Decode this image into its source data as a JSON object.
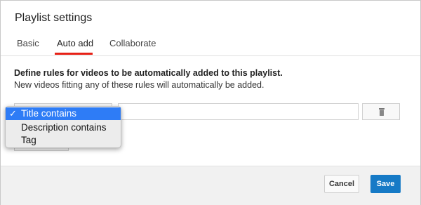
{
  "dialog": {
    "title": "Playlist settings"
  },
  "tabs": [
    {
      "label": "Basic",
      "active": false
    },
    {
      "label": "Auto add",
      "active": true
    },
    {
      "label": "Collaborate",
      "active": false
    }
  ],
  "rules": {
    "heading": "Define rules for videos to be automatically added to this playlist.",
    "subtext": "New videos fitting any of these rules will automatically be added.",
    "input_value": ""
  },
  "dropdown": {
    "selected_index": 0,
    "options": [
      {
        "label": "Title contains",
        "checkmark": "✓"
      },
      {
        "label": "Description contains"
      },
      {
        "label": "Tag"
      }
    ]
  },
  "footer": {
    "cancel_label": "Cancel",
    "save_label": "Save"
  },
  "colors": {
    "accent_tab_underline": "#e62117",
    "save_button": "#167ac6",
    "dropdown_highlight": "#2e7cf6"
  },
  "icons": {
    "delete": "trash-icon"
  }
}
